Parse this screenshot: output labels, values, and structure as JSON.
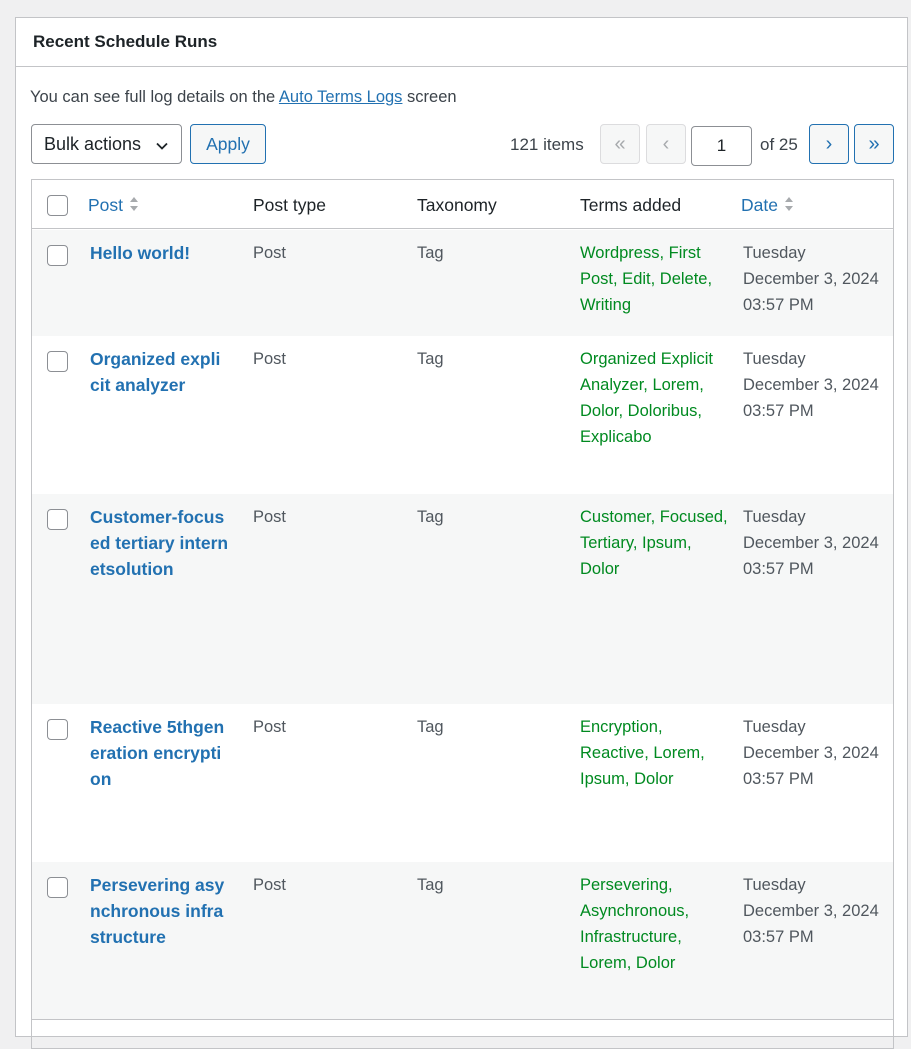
{
  "panel": {
    "title": "Recent Schedule Runs",
    "intro_prefix": "You can see full log details on the ",
    "intro_link": "Auto Terms Logs",
    "intro_suffix": " screen"
  },
  "toolbar": {
    "bulk_actions": "Bulk actions",
    "apply": "Apply",
    "items_count": "121 items",
    "first_page": "«",
    "prev_page": "‹",
    "current_page": "1",
    "of_pages": "of 25",
    "next_page": "›",
    "last_page": "»"
  },
  "table": {
    "columns": {
      "post": "Post",
      "post_type": "Post type",
      "taxonomy": "Taxonomy",
      "terms_added": "Terms added",
      "date": "Date"
    },
    "rows": [
      {
        "post": "Hello world!",
        "post_type": "Post",
        "taxonomy": "Tag",
        "terms": "Wordpress, First Post, Edit, Delete, Writing",
        "date": "Tuesday December 3, 2024 03:57 PM"
      },
      {
        "post": "Organized explicit analyzer",
        "post_type": "Post",
        "taxonomy": "Tag",
        "terms": "Organized Explicit Analyzer, Lorem, Dolor, Doloribus, Explicabo",
        "date": "Tuesday December 3, 2024 03:57 PM"
      },
      {
        "post": "Customer-focused tertiary internetsolution",
        "post_type": "Post",
        "taxonomy": "Tag",
        "terms": "Customer, Focused, Tertiary, Ipsum, Dolor",
        "date": "Tuesday December 3, 2024 03:57 PM"
      },
      {
        "post": "Reactive 5thgeneration encryption",
        "post_type": "Post",
        "taxonomy": "Tag",
        "terms": "Encryption, Reactive, Lorem, Ipsum, Dolor",
        "date": "Tuesday December 3, 2024 03:57 PM"
      },
      {
        "post": "Persevering asynchronous infrastructure",
        "post_type": "Post",
        "taxonomy": "Tag",
        "terms": "Persevering, Asynchronous, Infrastructure, Lorem, Dolor",
        "date": "Tuesday December 3, 2024 03:57 PM"
      }
    ]
  },
  "colors": {
    "link": "#2271b1",
    "terms": "#008a20",
    "alt_row": "#f6f7f7",
    "border": "#c3c4c7"
  }
}
